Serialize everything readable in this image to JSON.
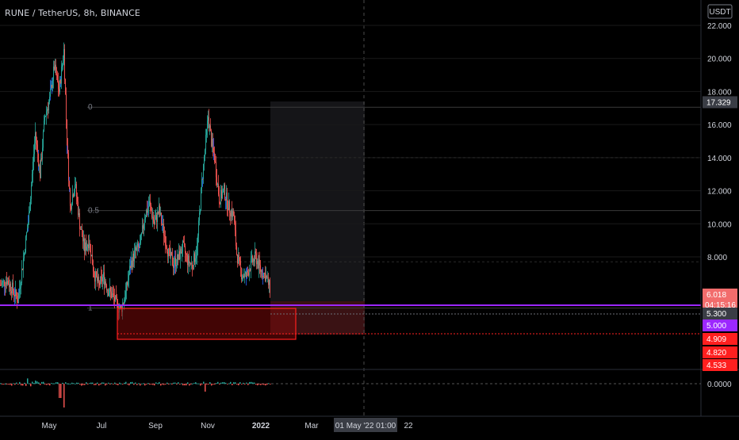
{
  "header": {
    "symbol_title": "RUNE / TetherUS, 8h, BINANCE"
  },
  "currency_label": "USDT",
  "colors": {
    "bull": "#26a69a",
    "bear": "#ef5350",
    "wick_blue": "#2962ff",
    "purple": "#9c27ff",
    "box_red": "#ff1f1f",
    "projection": "#2a2a2e",
    "grid": "#1a1a1a",
    "axis_text": "#d1d4dc"
  },
  "price_axis": {
    "ticks": [
      "22.000",
      "20.000",
      "18.000",
      "16.000",
      "14.000",
      "12.000",
      "10.000",
      "8.000"
    ],
    "tags": [
      {
        "name": "high-price-tag",
        "value": 17.329,
        "label": "17.329",
        "bg": "#3a3d45",
        "fg": "#ffffff"
      },
      {
        "name": "last-price-tag",
        "value": 6.018,
        "label": "6.018",
        "sub": "04:15:16",
        "bg": "#f26c6c",
        "fg": "#ffffff"
      },
      {
        "name": "level-5300-tag",
        "value": 5.3,
        "label": "5.300",
        "bg": "#3a3d45",
        "fg": "#ffffff"
      },
      {
        "name": "level-5000-tag",
        "value": 5.0,
        "label": "5.000",
        "bg": "#9c27ff",
        "fg": "#ffffff"
      },
      {
        "name": "level-4909-tag",
        "value": 4.909,
        "label": "4.909",
        "bg": "#ff1f1f",
        "fg": "#ffffff"
      },
      {
        "name": "level-4820-tag",
        "value": 4.82,
        "label": "4.820",
        "bg": "#ff1f1f",
        "fg": "#ffffff"
      },
      {
        "name": "level-4533-tag",
        "value": 4.533,
        "label": "4.533",
        "bg": "#ff1f1f",
        "fg": "#ffffff"
      }
    ]
  },
  "time_axis": {
    "ticks": [
      "May",
      "Jul",
      "Sep",
      "Nov",
      "2022",
      "Mar",
      "22"
    ],
    "crosshair_label": "01 May '22   01:00"
  },
  "fib_levels": [
    {
      "label": "0",
      "value": 17.05
    },
    {
      "label": "0.5",
      "value": 10.8
    },
    {
      "label": "1",
      "value": 4.9
    }
  ],
  "indicator": {
    "zero_label": "0.0000"
  }
}
